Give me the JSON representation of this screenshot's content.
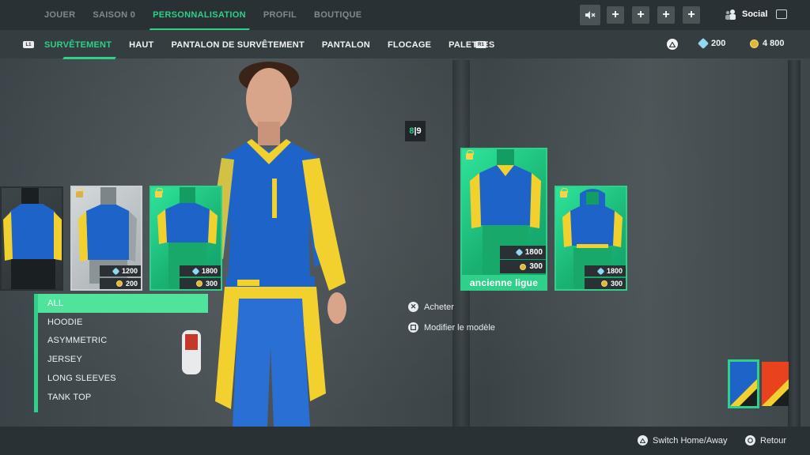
{
  "top_nav": {
    "items": [
      "JOUER",
      "SAISON 0",
      "PERSONNALISATION",
      "PROFIL",
      "BOUTIQUE"
    ],
    "active": "PERSONNALISATION"
  },
  "top_right": {
    "social_label": "Social",
    "plus_buttons": [
      "+",
      "+",
      "+",
      "+"
    ]
  },
  "tabs": {
    "items": [
      "SURVÊTEMENT",
      "HAUT",
      "PANTALON DE SURVÊTEMENT",
      "PANTALON",
      "FLOCAGE",
      "PALETTES"
    ],
    "active": "SURVÊTEMENT",
    "left_bumper": "L1",
    "right_bumper": "R1"
  },
  "currency": {
    "gems": "200",
    "coins": "4 800"
  },
  "counter": {
    "current": "8",
    "separator": "|",
    "total": "9"
  },
  "cards": [
    {
      "id": "card-1",
      "style": "dark",
      "locked": false
    },
    {
      "id": "card-2",
      "style": "grey",
      "locked": false,
      "gems": "1200",
      "coins": "200"
    },
    {
      "id": "card-3",
      "style": "green",
      "locked": true,
      "gems": "1800",
      "coins": "300"
    },
    {
      "id": "card-selected",
      "style": "green",
      "locked": true,
      "gems": "1800",
      "coins": "300",
      "label": "ancienne ligue"
    },
    {
      "id": "card-5",
      "style": "green",
      "locked": true,
      "gems": "1800",
      "coins": "300"
    }
  ],
  "filters": {
    "items": [
      "ALL",
      "HOODIE",
      "ASYMMETRIC",
      "JERSEY",
      "LONG SLEEVES",
      "TANK TOP"
    ],
    "active": "ALL"
  },
  "actions": {
    "buy": "Acheter",
    "edit": "Modifier le modèle"
  },
  "footer": {
    "switch": "Switch Home/Away",
    "back": "Retour"
  },
  "colors": {
    "accent": "#2fd08a",
    "kit_blue": "#1e64c8",
    "kit_yellow": "#f2d12e"
  }
}
